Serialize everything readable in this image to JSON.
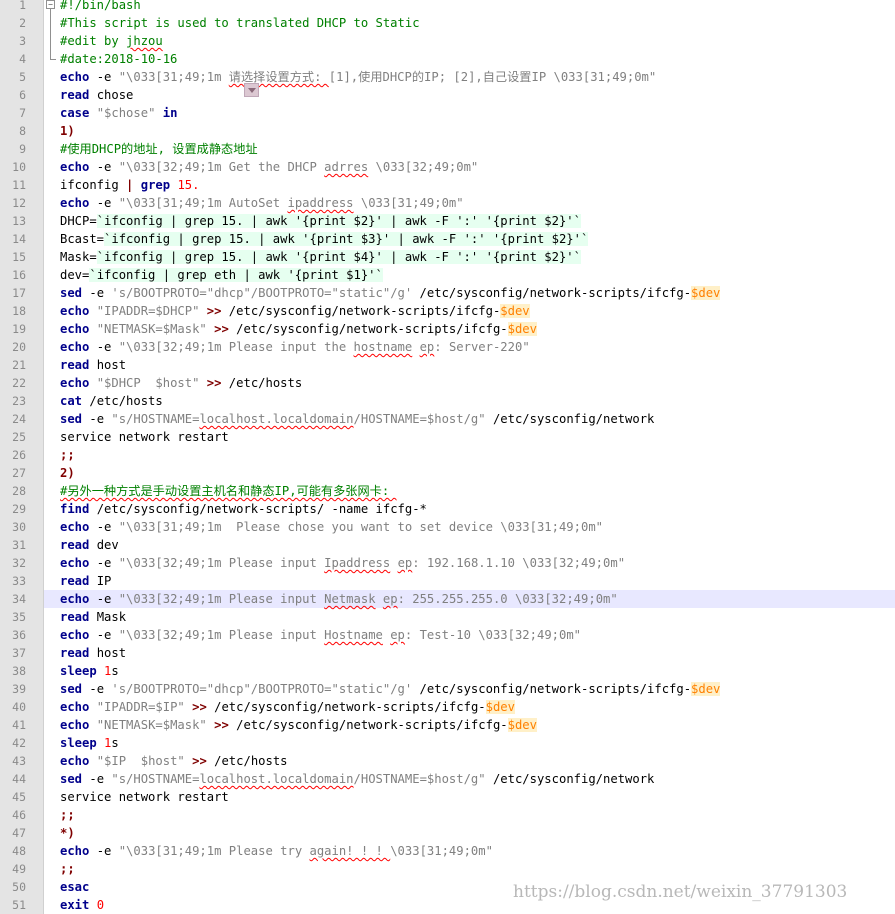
{
  "editor": {
    "current_line": 34,
    "lines": [
      [
        [
          "#!/bin/bash",
          "cm"
        ]
      ],
      [
        [
          "#This script is used to translated DHCP to Static",
          "cm"
        ]
      ],
      [
        [
          "#edit by ",
          "cm"
        ],
        [
          "jhzou",
          "cm sq"
        ]
      ],
      [
        [
          "#date:2018-10-16",
          "cm"
        ]
      ],
      [
        [
          "echo",
          "kw"
        ],
        [
          " -e ",
          ""
        ],
        [
          "\"\\033[31;49;1m ",
          "str"
        ],
        [
          "请选择设置方式: ",
          "str sq"
        ],
        [
          "[1],使用DHCP的IP; [2],自己设置IP \\033[31;49;0m\"",
          "str"
        ]
      ],
      [
        [
          "read",
          "kw"
        ],
        [
          " chose",
          ""
        ]
      ],
      [
        [
          "case",
          "kw"
        ],
        [
          " ",
          ""
        ],
        [
          "\"$chose\"",
          "str"
        ],
        [
          " ",
          ""
        ],
        [
          "in",
          "kw"
        ]
      ],
      [
        [
          "1)",
          "op"
        ]
      ],
      [
        [
          "#使用DHCP的地址, 设置成静态地址",
          "cm"
        ]
      ],
      [
        [
          "echo",
          "kw"
        ],
        [
          " -e ",
          ""
        ],
        [
          "\"\\033[32;49;1m Get the DHCP ",
          "str"
        ],
        [
          "adrres",
          "str sq"
        ],
        [
          " \\033[32;49;0m\"",
          "str"
        ]
      ],
      [
        [
          "ifconfig ",
          ""
        ],
        [
          "|",
          "op"
        ],
        [
          " ",
          ""
        ],
        [
          "grep",
          "kw"
        ],
        [
          " ",
          ""
        ],
        [
          "15.",
          "num"
        ]
      ],
      [
        [
          "echo",
          "kw"
        ],
        [
          " -e ",
          ""
        ],
        [
          "\"\\033[31;49;1m AutoSet ",
          "str"
        ],
        [
          "ipaddress",
          "str sq"
        ],
        [
          " \\033[31;49;0m\"",
          "str"
        ]
      ],
      [
        [
          "DHCP=",
          ""
        ],
        [
          "`ifconfig | grep 15. | awk '{print $2}' | awk -F ':' '{print $2}'`",
          "bt"
        ]
      ],
      [
        [
          "Bcast=",
          ""
        ],
        [
          "`ifconfig | grep 15. | awk '{print $3}' | awk -F ':' '{print $2}'`",
          "bt"
        ]
      ],
      [
        [
          "Mask=",
          ""
        ],
        [
          "`ifconfig | grep 15. | awk '{print $4}' | awk -F ':' '{print $2}'`",
          "bt"
        ]
      ],
      [
        [
          "dev=",
          ""
        ],
        [
          "`ifconfig | grep eth | awk '{print $1}'`",
          "bt"
        ]
      ],
      [
        [
          "sed",
          "kw"
        ],
        [
          " -e ",
          ""
        ],
        [
          "'s/BOOTPROTO=\"dhcp\"/BOOTPROTO=\"static\"/g'",
          "str"
        ],
        [
          " /etc/sysconfig/network-scripts/ifcfg-",
          ""
        ],
        [
          "$dev",
          "var"
        ]
      ],
      [
        [
          "echo",
          "kw"
        ],
        [
          " ",
          ""
        ],
        [
          "\"IPADDR=$DHCP\"",
          "str"
        ],
        [
          " ",
          ""
        ],
        [
          ">>",
          "op"
        ],
        [
          " /etc/sysconfig/network-scripts/ifcfg-",
          ""
        ],
        [
          "$dev",
          "var"
        ]
      ],
      [
        [
          "echo",
          "kw"
        ],
        [
          " ",
          ""
        ],
        [
          "\"NETMASK=$Mask\"",
          "str"
        ],
        [
          " ",
          ""
        ],
        [
          ">>",
          "op"
        ],
        [
          " /etc/sysconfig/network-scripts/ifcfg-",
          ""
        ],
        [
          "$dev",
          "var"
        ]
      ],
      [
        [
          "echo",
          "kw"
        ],
        [
          " -e ",
          ""
        ],
        [
          "\"\\033[32;49;1m Please input the ",
          "str"
        ],
        [
          "hostname",
          "str sq"
        ],
        [
          " ",
          "str"
        ],
        [
          "ep",
          "str sq"
        ],
        [
          ": Server-220\"",
          "str"
        ]
      ],
      [
        [
          "read",
          "kw"
        ],
        [
          " host",
          ""
        ]
      ],
      [
        [
          "echo",
          "kw"
        ],
        [
          " ",
          ""
        ],
        [
          "\"$DHCP  $host\"",
          "str"
        ],
        [
          " ",
          ""
        ],
        [
          ">>",
          "op"
        ],
        [
          " /etc/hosts",
          ""
        ]
      ],
      [
        [
          "cat",
          "kw"
        ],
        [
          " /etc/hosts",
          ""
        ]
      ],
      [
        [
          "sed",
          "kw"
        ],
        [
          " -e ",
          ""
        ],
        [
          "\"s/HOSTNAME=",
          "str"
        ],
        [
          "localhost.localdomain",
          "str sq"
        ],
        [
          "/HOSTNAME=$host/g\"",
          "str"
        ],
        [
          " /etc/sysconfig/network",
          ""
        ]
      ],
      [
        [
          "service network restart",
          ""
        ]
      ],
      [
        [
          ";;",
          "op"
        ]
      ],
      [
        [
          "2)",
          "op"
        ]
      ],
      [
        [
          "#另外一种方式是手动设置主机名和静态IP,可能有多张网卡: ",
          "cm sq"
        ]
      ],
      [
        [
          "find",
          "kw"
        ],
        [
          " /etc/sysconfig/network-scripts/ -name ifcfg-*",
          ""
        ]
      ],
      [
        [
          "echo",
          "kw"
        ],
        [
          " -e ",
          ""
        ],
        [
          "\"\\033[31;49;1m  Please chose you want to set device \\033[31;49;0m\"",
          "str"
        ]
      ],
      [
        [
          "read",
          "kw"
        ],
        [
          " dev",
          ""
        ]
      ],
      [
        [
          "echo",
          "kw"
        ],
        [
          " -e ",
          ""
        ],
        [
          "\"\\033[32;49;1m Please input ",
          "str"
        ],
        [
          "Ipaddress",
          "str sq"
        ],
        [
          " ",
          "str"
        ],
        [
          "ep",
          "str sq"
        ],
        [
          ": 192.168.1.10 \\033[32;49;0m\"",
          "str"
        ]
      ],
      [
        [
          "read",
          "kw"
        ],
        [
          " IP",
          ""
        ]
      ],
      [
        [
          "echo",
          "kw"
        ],
        [
          " -e ",
          ""
        ],
        [
          "\"\\033[32;49;1m Please input ",
          "str"
        ],
        [
          "Netmask",
          "str sq"
        ],
        [
          " ",
          "str"
        ],
        [
          "ep",
          "str sq"
        ],
        [
          ": 255.255.255.0 \\033[32;49;0m\"",
          "str"
        ]
      ],
      [
        [
          "read",
          "kw"
        ],
        [
          " Mask",
          ""
        ]
      ],
      [
        [
          "echo",
          "kw"
        ],
        [
          " -e ",
          ""
        ],
        [
          "\"\\033[32;49;1m Please input ",
          "str"
        ],
        [
          "Hostname",
          "str sq"
        ],
        [
          " ",
          "str"
        ],
        [
          "ep",
          "str sq"
        ],
        [
          ": Test-10 \\033[32;49;0m\"",
          "str"
        ]
      ],
      [
        [
          "read",
          "kw"
        ],
        [
          " host",
          ""
        ]
      ],
      [
        [
          "sleep",
          "kw"
        ],
        [
          " ",
          ""
        ],
        [
          "1",
          "num"
        ],
        [
          "s",
          ""
        ]
      ],
      [
        [
          "sed",
          "kw"
        ],
        [
          " -e ",
          ""
        ],
        [
          "'s/BOOTPROTO=\"dhcp\"/BOOTPROTO=\"static\"/g'",
          "str"
        ],
        [
          " /etc/sysconfig/network-scripts/ifcfg-",
          ""
        ],
        [
          "$dev",
          "var"
        ]
      ],
      [
        [
          "echo",
          "kw"
        ],
        [
          " ",
          ""
        ],
        [
          "\"IPADDR=$IP\"",
          "str"
        ],
        [
          " ",
          ""
        ],
        [
          ">>",
          "op"
        ],
        [
          " /etc/sysconfig/network-scripts/ifcfg-",
          ""
        ],
        [
          "$dev",
          "var"
        ]
      ],
      [
        [
          "echo",
          "kw"
        ],
        [
          " ",
          ""
        ],
        [
          "\"NETMASK=$Mask\"",
          "str"
        ],
        [
          " ",
          ""
        ],
        [
          ">>",
          "op"
        ],
        [
          " /etc/sysconfig/network-scripts/ifcfg-",
          ""
        ],
        [
          "$dev",
          "var"
        ]
      ],
      [
        [
          "sleep",
          "kw"
        ],
        [
          " ",
          ""
        ],
        [
          "1",
          "num"
        ],
        [
          "s",
          ""
        ]
      ],
      [
        [
          "echo",
          "kw"
        ],
        [
          " ",
          ""
        ],
        [
          "\"$IP  $host\"",
          "str"
        ],
        [
          " ",
          ""
        ],
        [
          ">>",
          "op"
        ],
        [
          " /etc/hosts",
          ""
        ]
      ],
      [
        [
          "sed",
          "kw"
        ],
        [
          " -e ",
          ""
        ],
        [
          "\"s/HOSTNAME=",
          "str"
        ],
        [
          "localhost.localdomain",
          "str sq"
        ],
        [
          "/HOSTNAME=$host/g\"",
          "str"
        ],
        [
          " /etc/sysconfig/network",
          ""
        ]
      ],
      [
        [
          "service network restart",
          ""
        ]
      ],
      [
        [
          ";;",
          "op"
        ]
      ],
      [
        [
          "*)",
          "op"
        ]
      ],
      [
        [
          "echo",
          "kw"
        ],
        [
          " -e ",
          ""
        ],
        [
          "\"\\033[31;49;1m Please try ",
          "str"
        ],
        [
          "again! ! ! ",
          "str sq"
        ],
        [
          "\\033[31;49;0m\"",
          "str"
        ]
      ],
      [
        [
          ";;",
          "op"
        ]
      ],
      [
        [
          "esac",
          "kw"
        ]
      ],
      [
        [
          "exit",
          "kw"
        ],
        [
          " ",
          ""
        ],
        [
          "0",
          "num"
        ]
      ]
    ]
  },
  "watermark": "https://blog.csdn.net/weixin_37791303"
}
